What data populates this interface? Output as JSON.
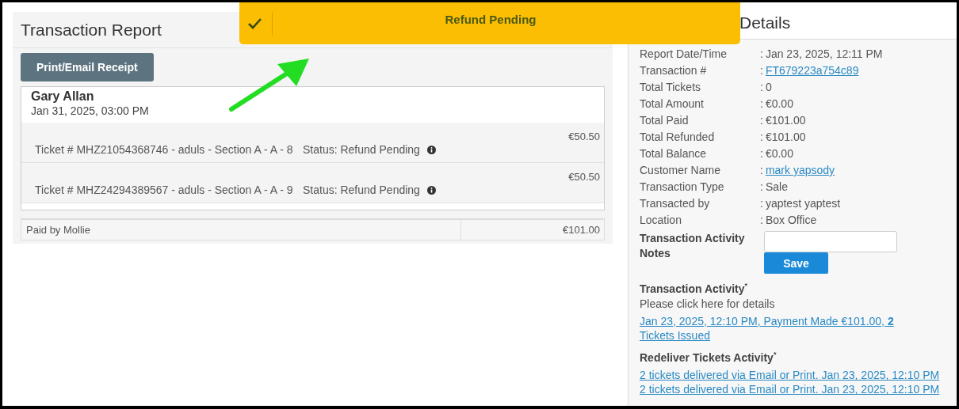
{
  "toast": {
    "text": "Refund Pending"
  },
  "report": {
    "title": "Transaction Report",
    "print_button": "Print/Email Receipt",
    "event": {
      "name": "Gary Allan",
      "date": "Jan 31, 2025, 03:00 PM"
    },
    "tickets": [
      {
        "description": "Ticket # MHZ21054368746 - aduls - Section A - A - 8",
        "status": "Status: Refund Pending",
        "price": "€50.50"
      },
      {
        "description": "Ticket # MHZ24294389567 - aduls - Section A - A - 9",
        "status": "Status: Refund Pending",
        "price": "€50.50"
      }
    ],
    "payment": {
      "method": "Paid by Mollie",
      "amount": "€101.00"
    }
  },
  "details": {
    "title": "Details",
    "separator": ":",
    "rows": [
      {
        "label": "Report Date/Time",
        "value": "Jan 23, 2025, 12:11 PM",
        "kind": "text"
      },
      {
        "label": "Transaction #",
        "value": "FT679223a754c89",
        "kind": "link"
      },
      {
        "label": "Total Tickets",
        "value": "0",
        "kind": "text"
      },
      {
        "label": "Total Amount",
        "value": "€0.00",
        "kind": "text"
      },
      {
        "label": "Total Paid",
        "value": "€101.00",
        "kind": "text"
      },
      {
        "label": "Total Refunded",
        "value": "€101.00",
        "kind": "text"
      },
      {
        "label": "Total Balance",
        "value": "€0.00",
        "kind": "text"
      },
      {
        "label": "Customer Name",
        "value": "mark yapsody",
        "kind": "link"
      },
      {
        "label": "Transaction Type",
        "value": "Sale",
        "kind": "text"
      },
      {
        "label": "Transacted by",
        "value": "yaptest yaptest",
        "kind": "text"
      },
      {
        "label": "Location",
        "value": "Box Office",
        "kind": "text"
      }
    ],
    "notes": {
      "label": "Transaction Activity Notes",
      "button": "Save"
    },
    "activity": {
      "title": "Transaction Activity$^{*}$",
      "hint": "Please click here for details",
      "links": [
        "Jan 23, 2025, 12:10 PM, Payment Made €101.00, **2** Tickets Issued"
      ]
    },
    "redeliver": {
      "title": "Redeliver Tickets Activity$^{*}$",
      "links": [
        "2 tickets delivered via Email or Print. Jan 23, 2025, 12:10 PM",
        "2 tickets delivered via Email or Print. Jan 23, 2025, 12:10 PM"
      ]
    }
  }
}
